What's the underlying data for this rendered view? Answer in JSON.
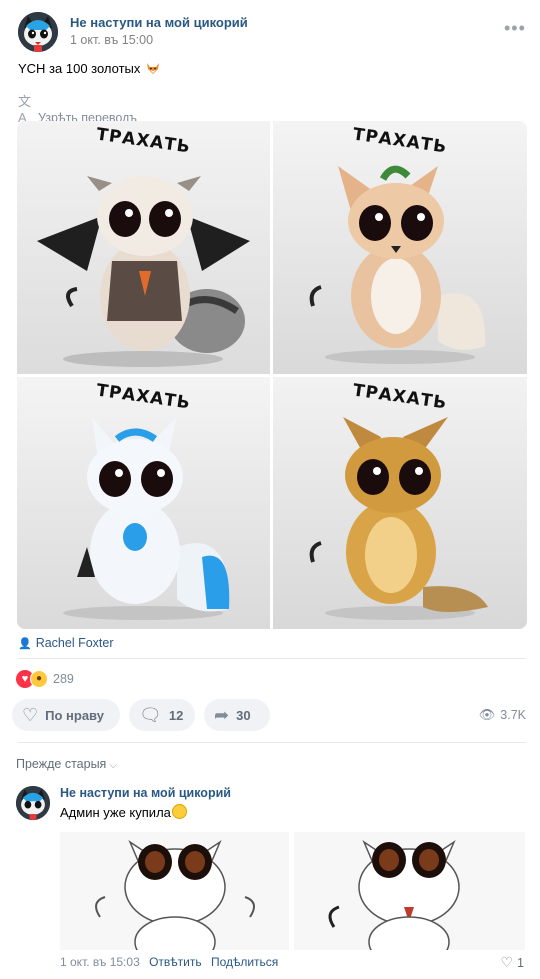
{
  "post": {
    "author": "Не наступи на мой цикорий",
    "date": "1 окт. въ 15:00",
    "more": "•••",
    "text": "YCH за 100 золотых",
    "translate": "Узрѣть переводъ",
    "photo_caption": "ТРАХАТЬ",
    "credit": "Rachel Foxter",
    "reactions_count": "289",
    "actions": {
      "like_label": "По нраву",
      "comments_count": "12",
      "shares_count": "30"
    },
    "views": "3.7K"
  },
  "comments": {
    "sort_label": "Прежде старыя",
    "items": [
      {
        "author": "Не наступи на мой цикорий",
        "text": "Админ уже купила",
        "date": "1 окт. въ 15:03",
        "reply": "Отвѣтить",
        "share": "Подѣлиться",
        "likes": "1"
      }
    ]
  },
  "icons": {
    "more": "more-horizontal-icon",
    "translate": "translate-icon",
    "credit": "user-icon",
    "like": "heart-outline-icon",
    "comment": "comment-icon",
    "share": "share-arrow-icon",
    "views": "eye-icon",
    "sort": "chevron-down-icon"
  },
  "colors": {
    "link": "#2a5885",
    "muted": "#818c99",
    "button_bg": "#f0f2f5",
    "reaction_heart": "#ff3347",
    "reaction_wow": "#ffc83d"
  }
}
